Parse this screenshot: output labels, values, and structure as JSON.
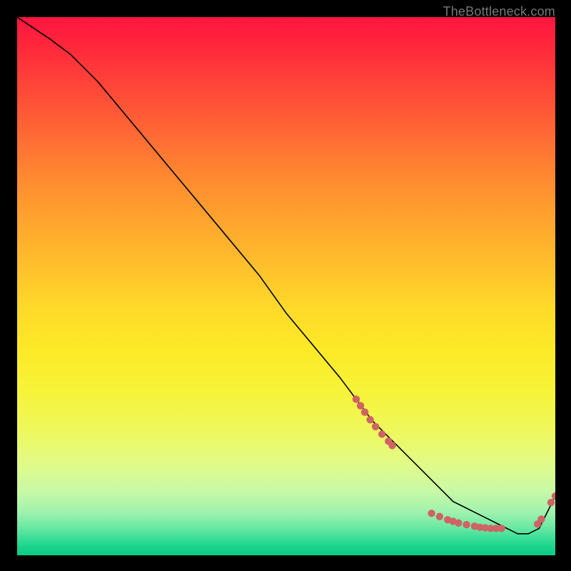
{
  "watermark": "TheBottleneck.com",
  "chart_data": {
    "type": "line",
    "title": "",
    "xlabel": "",
    "ylabel": "",
    "xlim": [
      0,
      100
    ],
    "ylim": [
      0,
      100
    ],
    "grid": false,
    "legend": false,
    "annotations": [],
    "series": [
      {
        "name": "bottleneck-curve",
        "color": "#000000",
        "x": [
          0,
          3,
          6,
          10,
          15,
          20,
          25,
          30,
          35,
          40,
          45,
          50,
          55,
          60,
          63,
          66,
          69,
          72,
          75,
          78,
          81,
          83,
          85,
          87,
          89,
          91,
          93,
          95,
          97,
          98,
          100
        ],
        "values": [
          100,
          98,
          96,
          93,
          88,
          82,
          76,
          70,
          64,
          58,
          52,
          45,
          39,
          33,
          29,
          25,
          22,
          19,
          16,
          13,
          10,
          9,
          8,
          7,
          6,
          5,
          4,
          4,
          5,
          7,
          11
        ]
      }
    ],
    "markers": [
      {
        "name": "marker-cluster-upper",
        "color": "#ce6464",
        "points": [
          {
            "x": 63.0,
            "y": 29.0
          },
          {
            "x": 63.8,
            "y": 27.8
          },
          {
            "x": 64.6,
            "y": 26.6
          },
          {
            "x": 65.6,
            "y": 25.2
          },
          {
            "x": 66.6,
            "y": 23.9
          },
          {
            "x": 67.8,
            "y": 22.5
          },
          {
            "x": 69.0,
            "y": 21.2
          },
          {
            "x": 69.7,
            "y": 20.4
          }
        ]
      },
      {
        "name": "marker-cluster-bottom",
        "color": "#ce6464",
        "points": [
          {
            "x": 77.0,
            "y": 7.8
          },
          {
            "x": 78.5,
            "y": 7.2
          },
          {
            "x": 80.0,
            "y": 6.6
          },
          {
            "x": 81.0,
            "y": 6.3
          },
          {
            "x": 82.0,
            "y": 6.0
          },
          {
            "x": 83.5,
            "y": 5.7
          },
          {
            "x": 85.0,
            "y": 5.4
          },
          {
            "x": 86.0,
            "y": 5.2
          },
          {
            "x": 87.0,
            "y": 5.1
          },
          {
            "x": 88.0,
            "y": 5.0
          },
          {
            "x": 89.0,
            "y": 5.0
          },
          {
            "x": 90.0,
            "y": 5.0
          }
        ]
      },
      {
        "name": "marker-cluster-right",
        "color": "#ce6464",
        "points": [
          {
            "x": 96.7,
            "y": 5.8
          },
          {
            "x": 97.4,
            "y": 6.7
          },
          {
            "x": 99.2,
            "y": 9.8
          },
          {
            "x": 100.0,
            "y": 11.0
          }
        ]
      }
    ]
  }
}
